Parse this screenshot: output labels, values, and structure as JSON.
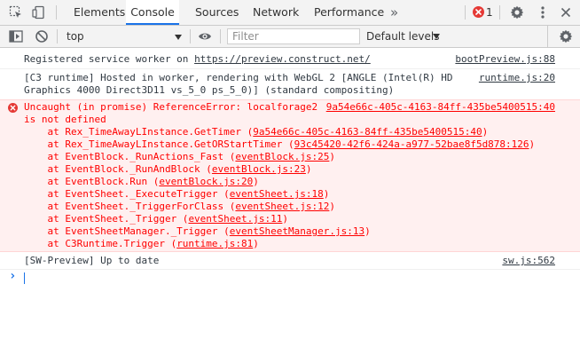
{
  "tabs": {
    "items": [
      {
        "label": "Elements"
      },
      {
        "label": "Console"
      },
      {
        "label": "Sources"
      },
      {
        "label": "Network"
      },
      {
        "label": "Performance"
      }
    ],
    "more": "»",
    "error_count": "1"
  },
  "toolbar": {
    "context": "top",
    "filter_placeholder": "Filter",
    "levels": "Default levels"
  },
  "messages": {
    "sw_registered": {
      "text": "Registered service worker on ",
      "link": "https://preview.construct.net/",
      "source": "bootPreview.js:88"
    },
    "c3_runtime": {
      "line1": "[C3 runtime] Hosted in worker, rendering with WebGL 2 [ANGLE (Intel(R) HD",
      "line2": "Graphics 4000 Direct3D11 vs_5_0 ps_5_0)] (standard compositing)",
      "source": "runtime.js:20"
    },
    "error": {
      "line1": "Uncaught (in promise) ReferenceError: localforage2",
      "line2": "is not defined",
      "source": "9a54e66c-405c-4163-84ff-435be5400515:40",
      "stack": [
        {
          "fn": "    at Rex_TimeAwayLInstance.GetTimer (",
          "loc": "9a54e66c-405c-4163-84ff-435be5400515:40",
          "end": ")"
        },
        {
          "fn": "    at Rex_TimeAwayLInstance.GetORStartTimer (",
          "loc": "93c45420-42f6-424a-a977-52bae8f5d878:126",
          "end": ")"
        },
        {
          "fn": "    at EventBlock._RunActions_Fast (",
          "loc": "eventBlock.js:25",
          "end": ")"
        },
        {
          "fn": "    at EventBlock._RunAndBlock (",
          "loc": "eventBlock.js:23",
          "end": ")"
        },
        {
          "fn": "    at EventBlock.Run (",
          "loc": "eventBlock.js:20",
          "end": ")"
        },
        {
          "fn": "    at EventSheet._ExecuteTrigger (",
          "loc": "eventSheet.js:18",
          "end": ")"
        },
        {
          "fn": "    at EventSheet._TriggerForClass (",
          "loc": "eventSheet.js:12",
          "end": ")"
        },
        {
          "fn": "    at EventSheet._Trigger (",
          "loc": "eventSheet.js:11",
          "end": ")"
        },
        {
          "fn": "    at EventSheetManager._Trigger (",
          "loc": "eventSheetManager.js:13",
          "end": ")"
        },
        {
          "fn": "    at C3Runtime.Trigger (",
          "loc": "runtime.js:81",
          "end": ")"
        }
      ]
    },
    "sw_preview": {
      "text": "[SW-Preview] Up to date",
      "source": "sw.js:562"
    }
  },
  "prompt": {
    "symbol": "›"
  },
  "colors": {
    "error_text": "#ff0000",
    "error_bg": "#fff0f0",
    "error_icon": "#e53935",
    "accent": "#1a73e8",
    "prompt_blue": "#1a73e8"
  }
}
